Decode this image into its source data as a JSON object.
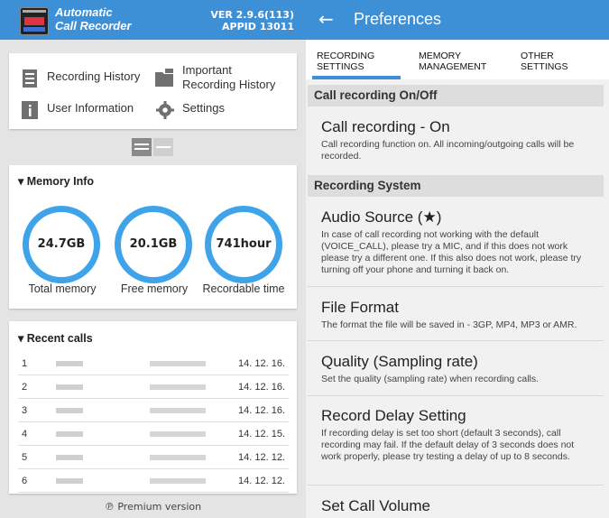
{
  "app": {
    "title_line1": "Automatic",
    "title_line2": "Call Recorder",
    "version": "VER 2.9.6(113)",
    "appid": "APPID 13011"
  },
  "menu": {
    "recording_history": "Recording History",
    "important_line1": "Important",
    "important_line2": "Recording History",
    "user_information": "User Information",
    "settings": "Settings"
  },
  "memory": {
    "header": "Memory Info",
    "total_value": "24.7GB",
    "total_label": "Total memory",
    "free_value": "20.1GB",
    "free_label": "Free memory",
    "rec_value": "741hour",
    "rec_label": "Recordable time"
  },
  "recent": {
    "header": "Recent calls",
    "rows": [
      {
        "n": "1",
        "date": "14. 12. 16."
      },
      {
        "n": "2",
        "date": "14. 12. 16."
      },
      {
        "n": "3",
        "date": "14. 12. 16."
      },
      {
        "n": "4",
        "date": "14. 12. 15."
      },
      {
        "n": "5",
        "date": "14. 12. 12."
      },
      {
        "n": "6",
        "date": "14. 12. 12."
      }
    ]
  },
  "premium": "℗ Premium version",
  "prefs": {
    "title": "Preferences",
    "tabs": {
      "t1l1": "RECORDING",
      "t1l2": "SETTINGS",
      "t2l1": "MEMORY",
      "t2l2": "MANAGEMENT",
      "t3l1": "OTHER",
      "t3l2": "SETTINGS"
    },
    "cat1": "Call recording On/Off",
    "cat2": "Recording System",
    "items": [
      {
        "title": "Call recording - On",
        "summary": "Call recording function on. All incoming/outgoing calls will be recorded."
      },
      {
        "title": "Audio Source (★)",
        "summary": "In case of call recording not working with the default (VOICE_CALL), please try a MIC, and if this does not work please try a different one. If this also does not work, please try turning off your phone and turning it back on."
      },
      {
        "title": "File Format",
        "summary": "The format the file will be saved in - 3GP, MP4, MP3 or AMR."
      },
      {
        "title": "Quality (Sampling rate)",
        "summary": "Set the quality (sampling rate) when recording calls."
      },
      {
        "title": "Record Delay Setting",
        "summary": "If recording delay is set too short (default 3 seconds), call recording may fail. If the default delay of 3 seconds does not work properly, please try testing a delay of up to 8 seconds."
      },
      {
        "title": "Set Call Volume",
        "summary": ""
      }
    ]
  },
  "colors": {
    "accent": "#3d8fd6",
    "ring": "#3fa3e9"
  }
}
